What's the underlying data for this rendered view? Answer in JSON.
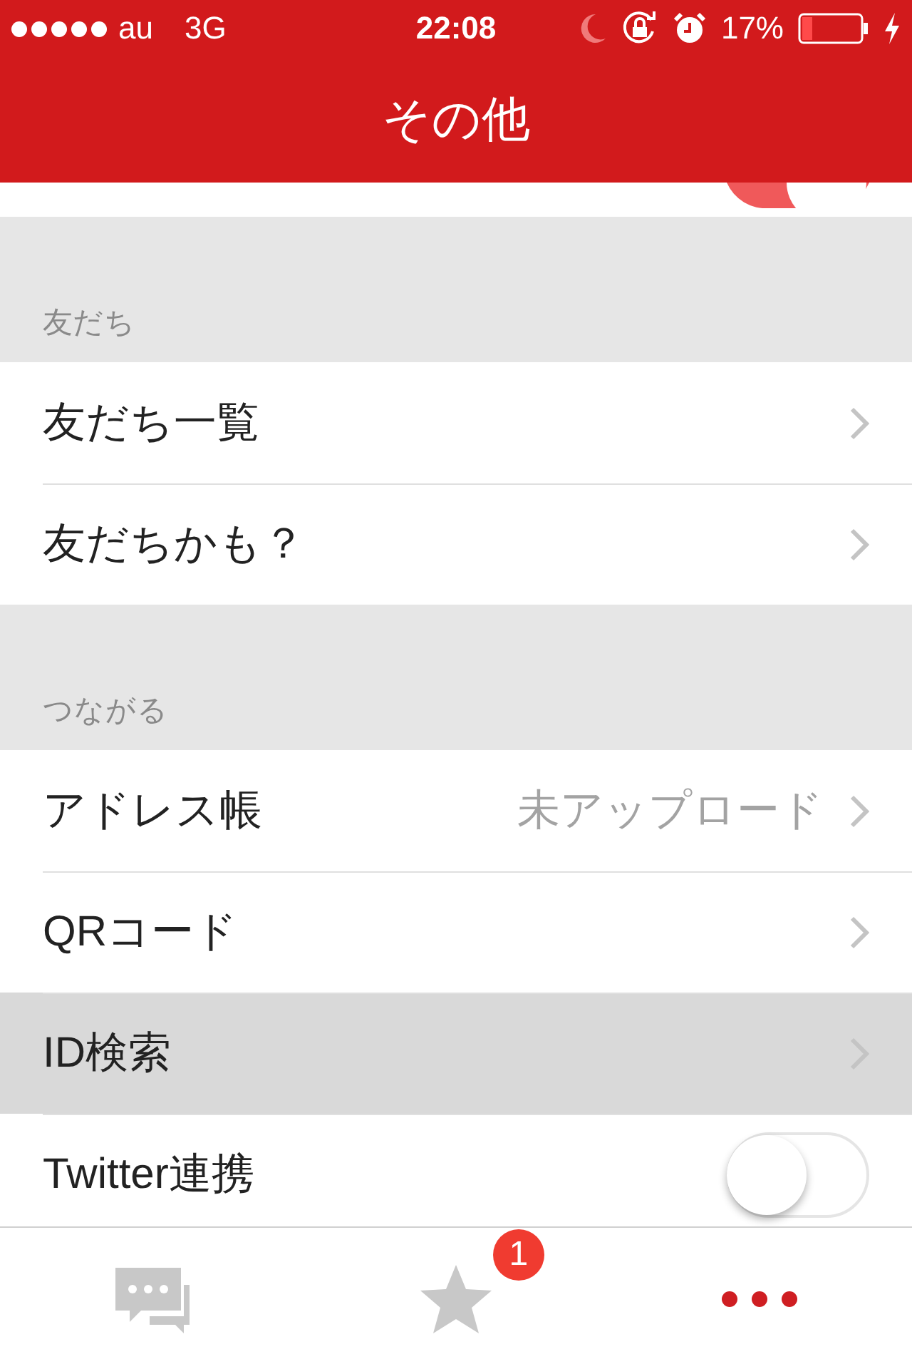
{
  "status_bar": {
    "carrier": "au",
    "network": "3G",
    "time": "22:08",
    "battery_percent": "17%"
  },
  "nav_bar": {
    "title": "その他"
  },
  "partial_row": {
    "kind": "toggle",
    "on": true
  },
  "sections": [
    {
      "header": "友だち",
      "rows": [
        {
          "kind": "link",
          "label": "友だち一覧",
          "selected": false
        },
        {
          "kind": "link",
          "label": "友だちかも？",
          "selected": false
        }
      ]
    },
    {
      "header": "つながる",
      "rows": [
        {
          "kind": "link",
          "label": "アドレス帳",
          "detail": "未アップロード",
          "selected": false
        },
        {
          "kind": "link",
          "label": "QRコード",
          "selected": false
        },
        {
          "kind": "link",
          "label": "ID検索",
          "selected": true
        },
        {
          "kind": "toggle",
          "label": "Twitter連携",
          "on": false
        }
      ]
    }
  ],
  "tab_bar": [
    {
      "kind": "chat",
      "selected": false
    },
    {
      "kind": "star",
      "selected": false,
      "badge": "1"
    },
    {
      "kind": "more",
      "selected": true
    }
  ]
}
